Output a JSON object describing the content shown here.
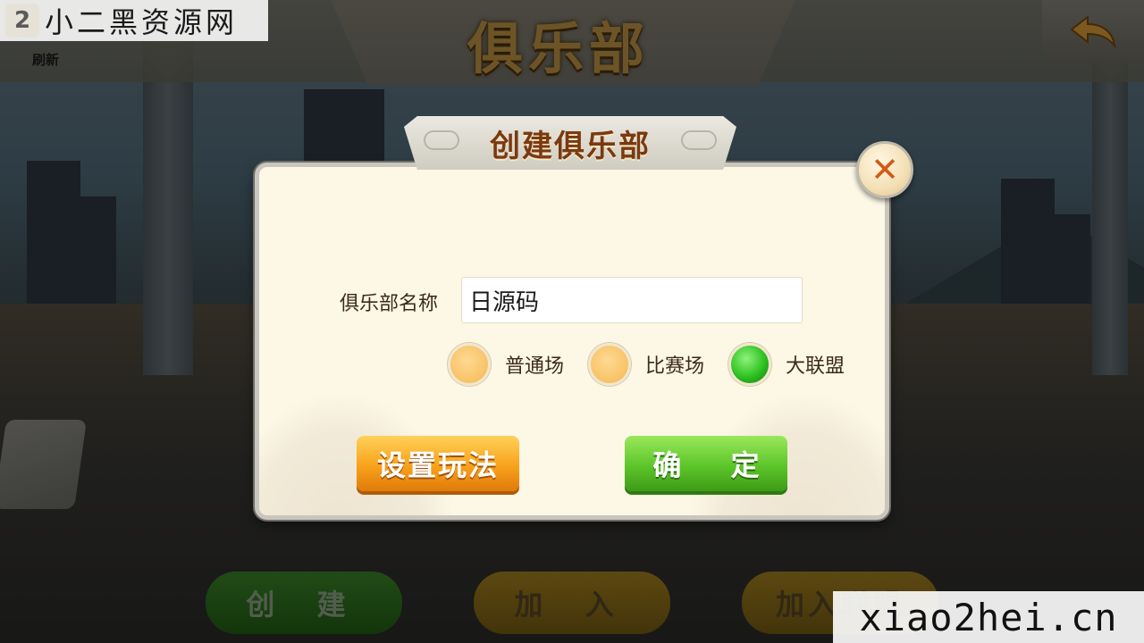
{
  "header": {
    "title": "俱乐部",
    "refresh_label": "刷新",
    "back_icon": "back-arrow-icon"
  },
  "watermarks": {
    "top_left_text": "小二黑资源网",
    "bottom_right_text": "xiao2hei.cn"
  },
  "bottom_nav": {
    "create_label": "创 建",
    "join_label": "加 入",
    "join_league_label": "加入联盟"
  },
  "dialog": {
    "title": "创建俱乐部",
    "close_icon": "close-x-icon",
    "name_label": "俱乐部名称",
    "name_value": "日源码",
    "radio_options": [
      {
        "label": "普通场",
        "checked": false
      },
      {
        "label": "比赛场",
        "checked": false
      },
      {
        "label": "大联盟",
        "checked": true
      }
    ],
    "set_rules_label": "设置玩法",
    "confirm_label": "确 定"
  },
  "colors": {
    "dialog_bg": "#fdf7e6",
    "title_brown": "#7a3a10",
    "radio_selected": "#2ec221",
    "radio_unselected": "#f7c265",
    "button_orange": "#f8a21b",
    "button_green": "#5cc52a",
    "close_x": "#d45a14"
  }
}
